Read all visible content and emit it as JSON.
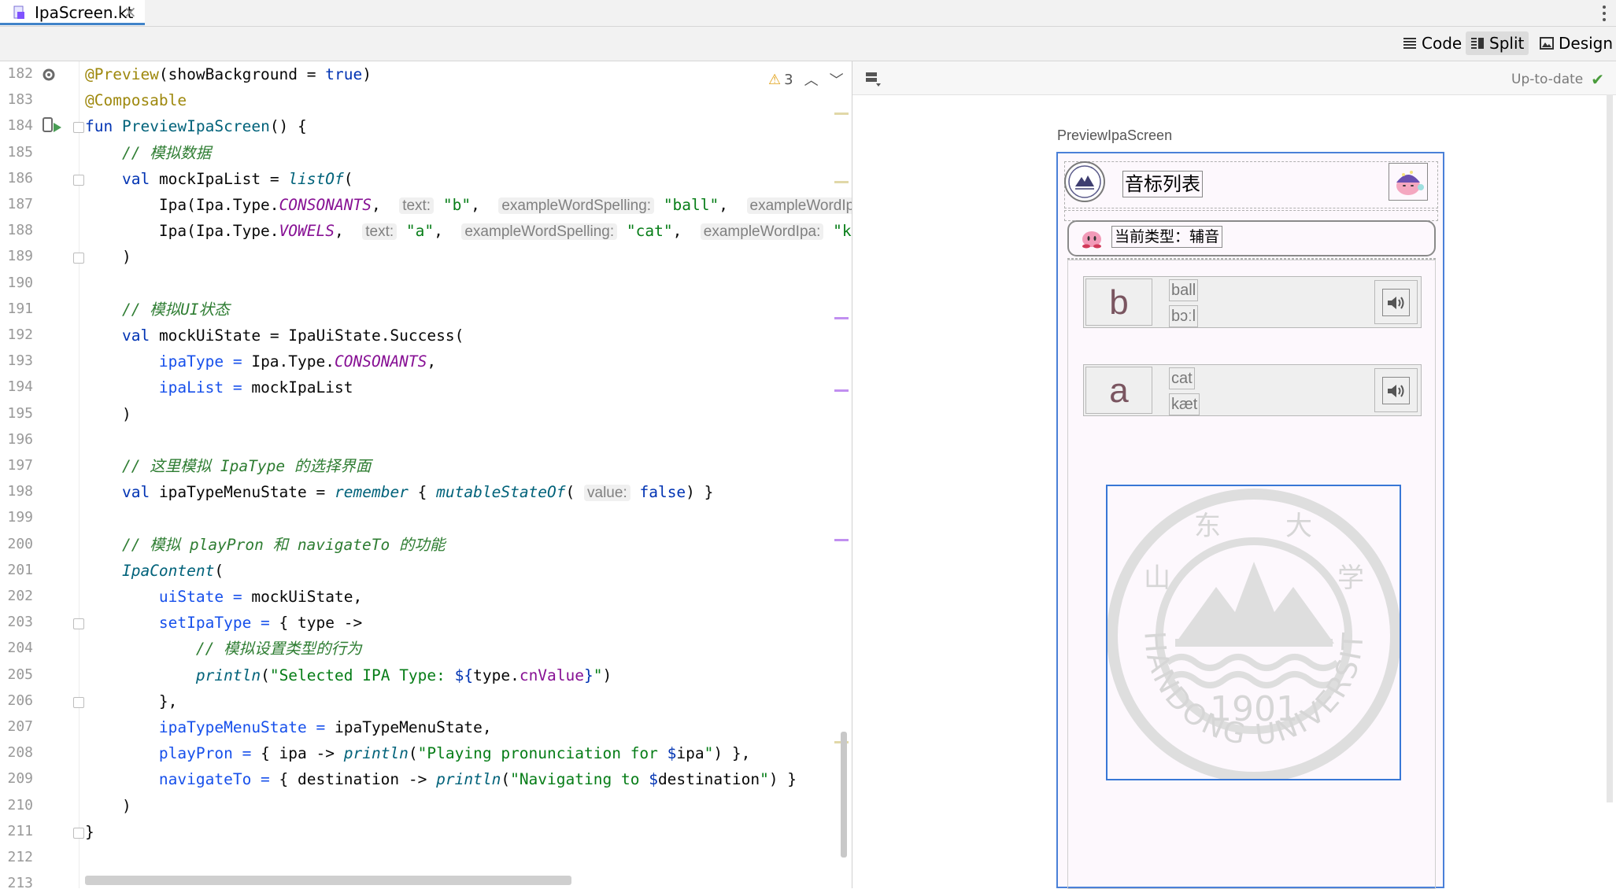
{
  "tab": {
    "filename": "IpaScreen.kt",
    "close": "×",
    "menu": "⋮"
  },
  "modes": {
    "code": "Code",
    "split": "Split",
    "design": "Design",
    "active": "Split"
  },
  "editor": {
    "warnings": "3",
    "line_numbers": [
      "182",
      "183",
      "184",
      "185",
      "186",
      "187",
      "188",
      "189",
      "190",
      "191",
      "192",
      "193",
      "194",
      "195",
      "196",
      "197",
      "198",
      "199",
      "200",
      "201",
      "202",
      "203",
      "204",
      "205",
      "206",
      "207",
      "208",
      "209",
      "210",
      "211",
      "212",
      "213"
    ],
    "lines": [
      [
        {
          "t": "@Preview",
          "c": "anno"
        },
        {
          "t": "(showBackground = ",
          "c": ""
        },
        {
          "t": "true",
          "c": "kw"
        },
        {
          "t": ")",
          "c": ""
        }
      ],
      [
        {
          "t": "@Composable",
          "c": "anno"
        }
      ],
      [
        {
          "t": "fun ",
          "c": "kw"
        },
        {
          "t": "PreviewIpaScreen",
          "c": "fn"
        },
        {
          "t": "() {",
          "c": ""
        }
      ],
      [
        {
          "t": "    // 模拟数据",
          "c": "cmt-g"
        }
      ],
      [
        {
          "t": "    ",
          "c": ""
        },
        {
          "t": "val ",
          "c": "kw"
        },
        {
          "t": "mockIpaList = ",
          "c": ""
        },
        {
          "t": "listOf",
          "c": "call"
        },
        {
          "t": "(",
          "c": ""
        }
      ],
      [
        {
          "t": "        Ipa(Ipa.Type.",
          "c": ""
        },
        {
          "t": "CONSONANTS",
          "c": "const"
        },
        {
          "t": ",  ",
          "c": ""
        },
        {
          "t": "text:",
          "c": "hint"
        },
        {
          "t": " ",
          "c": ""
        },
        {
          "t": "\"b\"",
          "c": "str"
        },
        {
          "t": ",  ",
          "c": ""
        },
        {
          "t": "exampleWordSpelling:",
          "c": "hint"
        },
        {
          "t": " ",
          "c": ""
        },
        {
          "t": "\"ball\"",
          "c": "str"
        },
        {
          "t": ",  ",
          "c": ""
        },
        {
          "t": "exampleWordIpa:",
          "c": "hint"
        }
      ],
      [
        {
          "t": "        Ipa(Ipa.Type.",
          "c": ""
        },
        {
          "t": "VOWELS",
          "c": "const"
        },
        {
          "t": ",  ",
          "c": ""
        },
        {
          "t": "text:",
          "c": "hint"
        },
        {
          "t": " ",
          "c": ""
        },
        {
          "t": "\"a\"",
          "c": "str"
        },
        {
          "t": ",  ",
          "c": ""
        },
        {
          "t": "exampleWordSpelling:",
          "c": "hint"
        },
        {
          "t": " ",
          "c": ""
        },
        {
          "t": "\"cat\"",
          "c": "str"
        },
        {
          "t": ",  ",
          "c": ""
        },
        {
          "t": "exampleWordIpa:",
          "c": "hint"
        },
        {
          "t": " ",
          "c": ""
        },
        {
          "t": "\"kæt\"",
          "c": "str"
        }
      ],
      [
        {
          "t": "    )",
          "c": ""
        }
      ],
      [
        {
          "t": "",
          "c": ""
        }
      ],
      [
        {
          "t": "    // 模拟UI状态",
          "c": "cmt-g"
        }
      ],
      [
        {
          "t": "    ",
          "c": ""
        },
        {
          "t": "val ",
          "c": "kw"
        },
        {
          "t": "mockUiState = IpaUiState.Success(",
          "c": ""
        }
      ],
      [
        {
          "t": "        ",
          "c": ""
        },
        {
          "t": "ipaType = ",
          "c": "param"
        },
        {
          "t": "Ipa.Type.",
          "c": ""
        },
        {
          "t": "CONSONANTS",
          "c": "const"
        },
        {
          "t": ",",
          "c": ""
        }
      ],
      [
        {
          "t": "        ",
          "c": ""
        },
        {
          "t": "ipaList = ",
          "c": "param"
        },
        {
          "t": "mockIpaList",
          "c": ""
        }
      ],
      [
        {
          "t": "    )",
          "c": ""
        }
      ],
      [
        {
          "t": "",
          "c": ""
        }
      ],
      [
        {
          "t": "    // 这里模拟 IpaType 的选择界面",
          "c": "cmt-g"
        }
      ],
      [
        {
          "t": "    ",
          "c": ""
        },
        {
          "t": "val ",
          "c": "kw"
        },
        {
          "t": "ipaTypeMenuState = ",
          "c": ""
        },
        {
          "t": "remember",
          "c": "call"
        },
        {
          "t": " { ",
          "c": ""
        },
        {
          "t": "mutableStateOf",
          "c": "call"
        },
        {
          "t": "( ",
          "c": ""
        },
        {
          "t": "value:",
          "c": "hint"
        },
        {
          "t": " ",
          "c": ""
        },
        {
          "t": "false",
          "c": "kw"
        },
        {
          "t": ") }",
          "c": ""
        }
      ],
      [
        {
          "t": "",
          "c": ""
        }
      ],
      [
        {
          "t": "    // 模拟 playPron 和 navigateTo 的功能",
          "c": "cmt-g"
        }
      ],
      [
        {
          "t": "    ",
          "c": ""
        },
        {
          "t": "IpaContent",
          "c": "call"
        },
        {
          "t": "(",
          "c": ""
        }
      ],
      [
        {
          "t": "        ",
          "c": ""
        },
        {
          "t": "uiState = ",
          "c": "param"
        },
        {
          "t": "mockUiState,",
          "c": ""
        }
      ],
      [
        {
          "t": "        ",
          "c": ""
        },
        {
          "t": "setIpaType = ",
          "c": "param"
        },
        {
          "t": "{ type ->",
          "c": ""
        }
      ],
      [
        {
          "t": "            // 模拟设置类型的行为",
          "c": "cmt-g"
        }
      ],
      [
        {
          "t": "            ",
          "c": ""
        },
        {
          "t": "println",
          "c": "call"
        },
        {
          "t": "(",
          "c": ""
        },
        {
          "t": "\"Selected IPA Type: ",
          "c": "str"
        },
        {
          "t": "${",
          "c": "kw"
        },
        {
          "t": "type.",
          "c": ""
        },
        {
          "t": "cnValue",
          "c": "prop"
        },
        {
          "t": "}",
          "c": "kw"
        },
        {
          "t": "\"",
          "c": "str"
        },
        {
          "t": ")",
          "c": ""
        }
      ],
      [
        {
          "t": "        },",
          "c": ""
        }
      ],
      [
        {
          "t": "        ",
          "c": ""
        },
        {
          "t": "ipaTypeMenuState = ",
          "c": "param"
        },
        {
          "t": "ipaTypeMenuState,",
          "c": ""
        }
      ],
      [
        {
          "t": "        ",
          "c": ""
        },
        {
          "t": "playPron = ",
          "c": "param"
        },
        {
          "t": "{ ipa -> ",
          "c": ""
        },
        {
          "t": "println",
          "c": "call"
        },
        {
          "t": "(",
          "c": ""
        },
        {
          "t": "\"Playing pronunciation for ",
          "c": "str"
        },
        {
          "t": "$",
          "c": "kw"
        },
        {
          "t": "ipa",
          "c": ""
        },
        {
          "t": "\"",
          "c": "str"
        },
        {
          "t": ") },",
          "c": ""
        }
      ],
      [
        {
          "t": "        ",
          "c": ""
        },
        {
          "t": "navigateTo = ",
          "c": "param"
        },
        {
          "t": "{ destination -> ",
          "c": ""
        },
        {
          "t": "println",
          "c": "call"
        },
        {
          "t": "(",
          "c": ""
        },
        {
          "t": "\"Navigating to ",
          "c": "str"
        },
        {
          "t": "$",
          "c": "kw"
        },
        {
          "t": "destination",
          "c": ""
        },
        {
          "t": "\"",
          "c": "str"
        },
        {
          "t": ") }",
          "c": ""
        }
      ],
      [
        {
          "t": "    )",
          "c": ""
        }
      ],
      [
        {
          "t": "}",
          "c": ""
        }
      ],
      [
        {
          "t": "",
          "c": ""
        }
      ],
      [
        {
          "t": "",
          "c": ""
        }
      ]
    ]
  },
  "preview": {
    "status": "Up-to-date",
    "composable_name": "PreviewIpaScreen",
    "screen_title": "音标列表",
    "current_type": "当前类型：辅音",
    "items": [
      {
        "symbol": "b",
        "word": "ball",
        "ipa": "bɔːl"
      },
      {
        "symbol": "a",
        "word": "cat",
        "ipa": "kæt"
      }
    ],
    "logo_year": "1901",
    "logo_text": "SHANDONG UNIVERSITY",
    "logo_chars": [
      "山",
      "东",
      "大",
      "学"
    ]
  },
  "colors": {
    "accent": "#4083c9",
    "device_border": "#4a80d8",
    "keyword": "#0033b3",
    "string": "#067d17",
    "comment": "#2e7d32",
    "annotation": "#9e880d",
    "constant": "#871094"
  }
}
